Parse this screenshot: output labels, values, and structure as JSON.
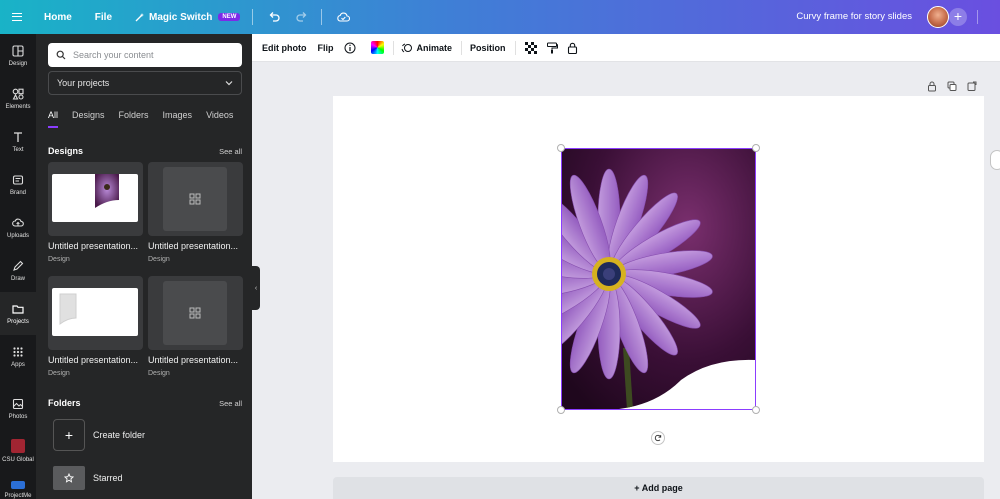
{
  "topbar": {
    "home": "Home",
    "file": "File",
    "magic_switch": "Magic Switch",
    "new_badge": "NEW",
    "doc_title": "Curvy frame for story slides",
    "add": "+"
  },
  "rail": {
    "items": [
      {
        "label": "Design",
        "icon": "layout-icon"
      },
      {
        "label": "Elements",
        "icon": "shapes-icon"
      },
      {
        "label": "Text",
        "icon": "text-icon"
      },
      {
        "label": "Brand",
        "icon": "brand-icon"
      },
      {
        "label": "Uploads",
        "icon": "upload-icon"
      },
      {
        "label": "Draw",
        "icon": "pen-icon"
      },
      {
        "label": "Projects",
        "icon": "folder-icon",
        "active": true
      },
      {
        "label": "Apps",
        "icon": "apps-grid-icon"
      },
      {
        "label": "Photos",
        "icon": "photo-icon"
      },
      {
        "label": "CSU Global",
        "icon": "csu-logo-icon"
      },
      {
        "label": "ProjectMe",
        "icon": "project-icon"
      }
    ]
  },
  "panel": {
    "search_placeholder": "Search your content",
    "dropdown": "Your projects",
    "tabs": [
      "All",
      "Designs",
      "Folders",
      "Images",
      "Videos"
    ],
    "designs_title": "Designs",
    "see_all": "See all",
    "designs": [
      {
        "name": "Untitled presentation...",
        "type": "Design"
      },
      {
        "name": "Untitled presentation...",
        "type": "Design"
      },
      {
        "name": "Untitled presentation...",
        "type": "Design"
      },
      {
        "name": "Untitled presentation...",
        "type": "Design"
      }
    ],
    "folders_title": "Folders",
    "create_folder": "Create folder",
    "starred": "Starred"
  },
  "context_toolbar": {
    "edit_photo": "Edit photo",
    "flip": "Flip",
    "animate": "Animate",
    "position": "Position"
  },
  "canvas": {
    "add_page": "+ Add page"
  },
  "colors": {
    "accent": "#8b3dff",
    "panel_bg": "#252627",
    "rail_bg": "#18191b"
  }
}
